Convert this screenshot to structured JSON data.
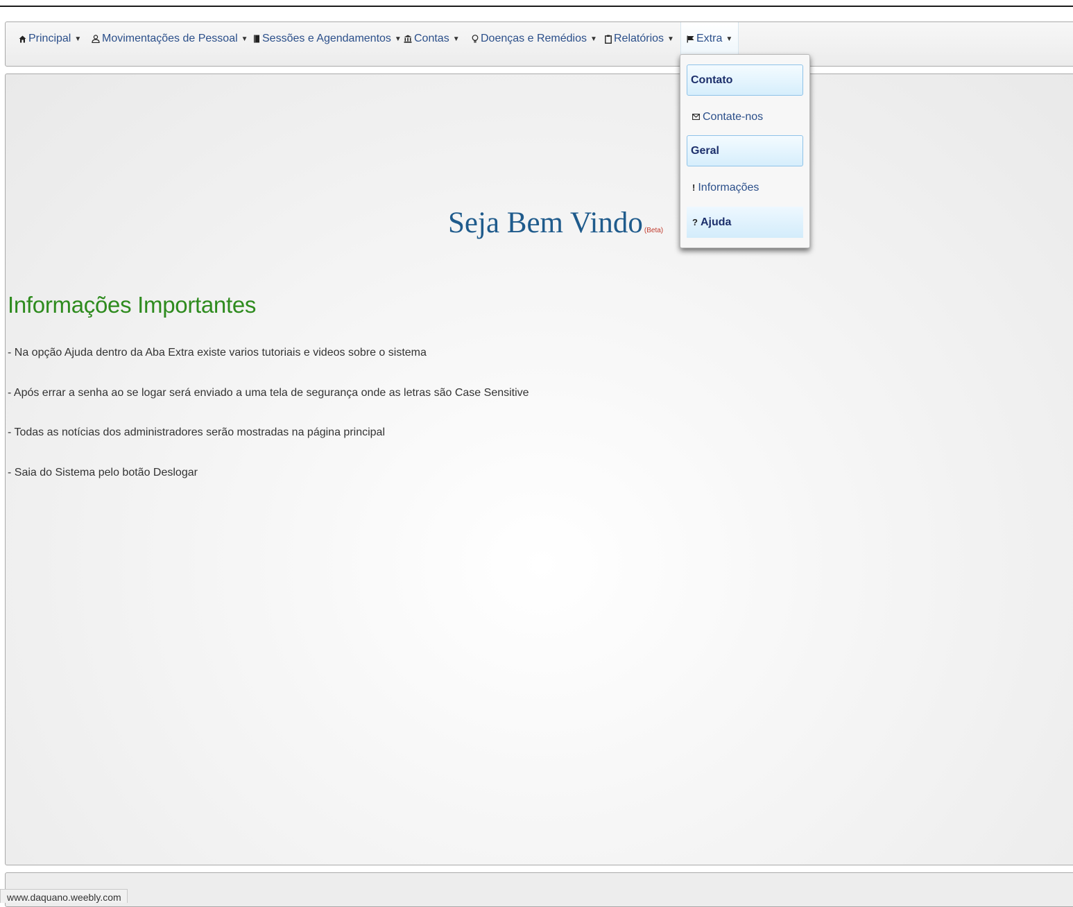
{
  "navbar": {
    "items": [
      {
        "label": "Principal",
        "icon": "home-icon",
        "glyph": "⌂"
      },
      {
        "label": "Movimentações de Pessoal",
        "icon": "user-icon",
        "glyph": "♙"
      },
      {
        "label": "Sessões e Agendamentos",
        "icon": "book-icon",
        "glyph": "▮"
      },
      {
        "label": "Contas",
        "icon": "bank-icon",
        "glyph": "⌂"
      },
      {
        "label": "Doenças e Remédios",
        "icon": "lightbulb-icon",
        "glyph": "♀"
      },
      {
        "label": "Relatórios",
        "icon": "clipboard-icon",
        "glyph": "▯"
      },
      {
        "label": "Extra",
        "icon": "flag-icon",
        "glyph": "⚑"
      }
    ],
    "caret": "▼"
  },
  "dropdown": {
    "sections": [
      {
        "header": "Contato"
      },
      {
        "item": "Contate-nos",
        "glyph": "✉"
      },
      {
        "header": "Geral"
      },
      {
        "item": "Informações",
        "glyph": "!"
      },
      {
        "item": "Ajuda",
        "glyph": "?"
      }
    ]
  },
  "main": {
    "welcome": "Seja Bem Vindo",
    "beta": "(Beta)",
    "info_title": "Informações Importantes",
    "info_lines": [
      "- Na opção Ajuda dentro da Aba Extra existe varios tutoriais e videos sobre o sistema",
      "- Após errar a senha ao se logar será enviado a uma tela de segurança onde as letras são Case Sensitive",
      "- Todas as notícias dos administradores serão mostradas na página principal",
      "- Saia do Sistema pelo botão Deslogar"
    ]
  },
  "status": {
    "url": "www.daquano.weebly.com"
  },
  "colors": {
    "link": "#2b4f8a",
    "title_green": "#2e8b1e",
    "welcome_blue": "#1f5b8c",
    "beta_red": "#c0392b"
  }
}
